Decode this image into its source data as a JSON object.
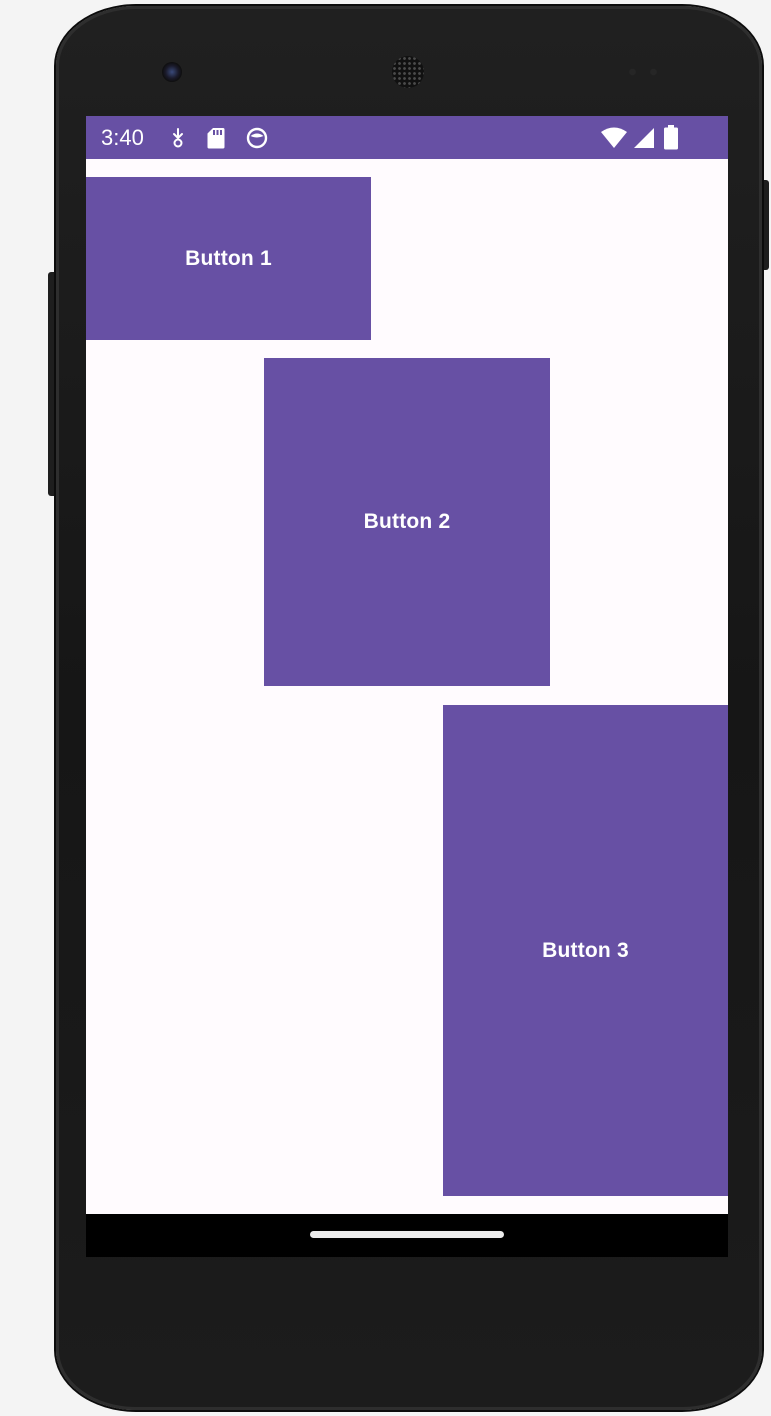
{
  "colors": {
    "accent": "#6750a4",
    "screen_background": "#fffbfe",
    "button_text": "#ffffff",
    "nav_bar": "#000000"
  },
  "status_bar": {
    "time": "3:40",
    "left_icons": [
      "download-icon",
      "sd-card-icon",
      "app-notification-icon"
    ],
    "right_icons": [
      "wifi-icon",
      "cellular-signal-icon",
      "battery-icon"
    ]
  },
  "buttons": [
    {
      "label": "Button 1"
    },
    {
      "label": "Button 2"
    },
    {
      "label": "Button 3"
    }
  ]
}
